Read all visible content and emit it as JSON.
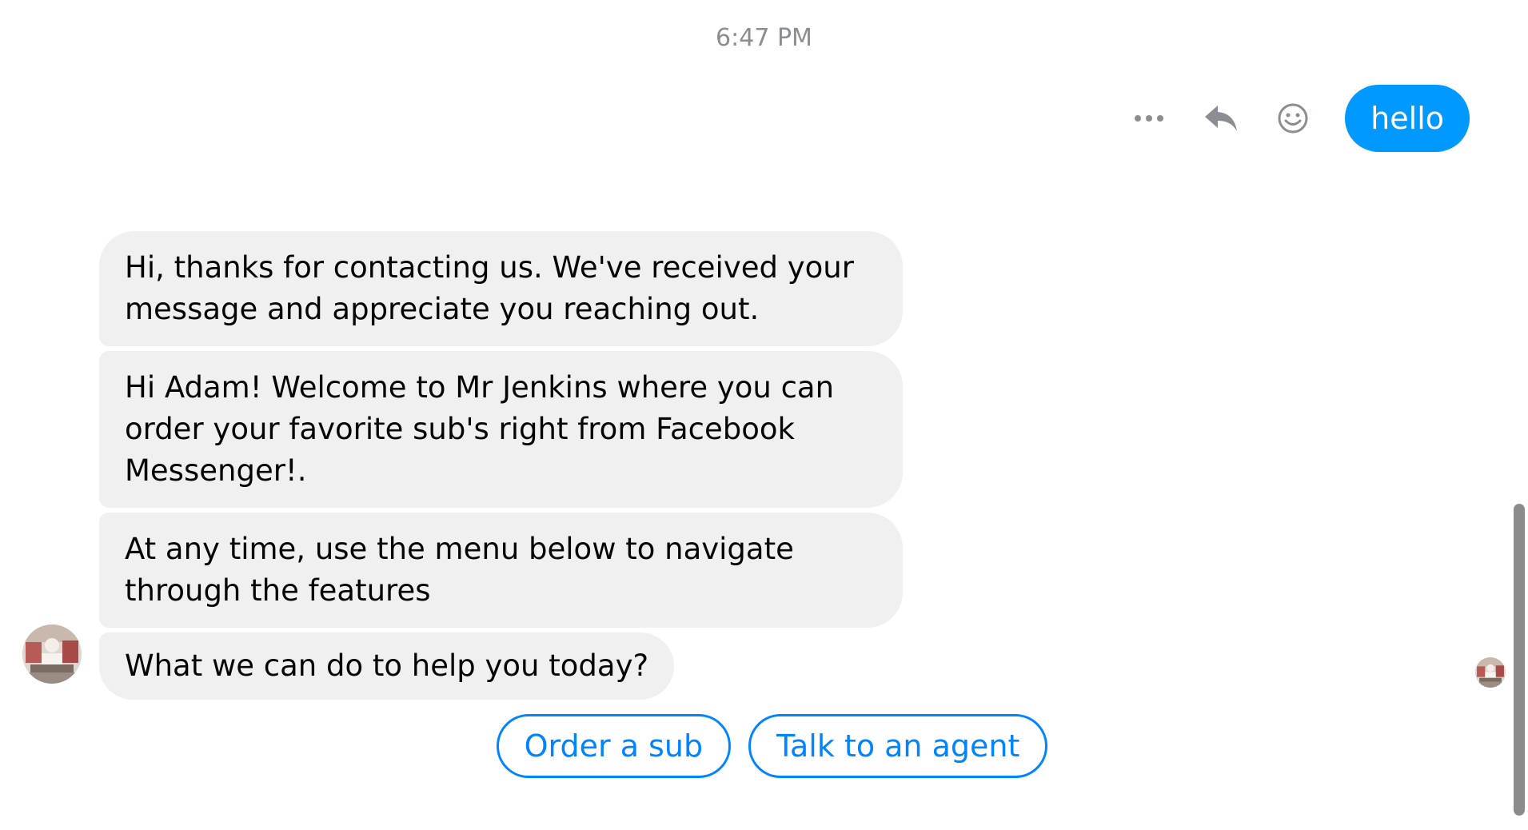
{
  "timestamp": "6:47 PM",
  "outgoing": {
    "text": "hello",
    "bubble_color": "#0099ff",
    "actions": [
      {
        "name": "more-icon"
      },
      {
        "name": "reply-icon"
      },
      {
        "name": "emoji-icon"
      }
    ]
  },
  "incoming": {
    "messages": [
      "Hi, thanks for contacting us. We've received your message and appreciate you reaching out.",
      "Hi Adam! Welcome to Mr Jenkins where you can order your favorite sub's right from Facebook Messenger!.",
      "At any time, use the menu below to navigate through the features",
      "What we can do to help you today?"
    ],
    "bubble_color": "#f0f0f0"
  },
  "quick_replies": [
    "Order a sub",
    "Talk to an agent"
  ],
  "accent_color": "#0084ff"
}
